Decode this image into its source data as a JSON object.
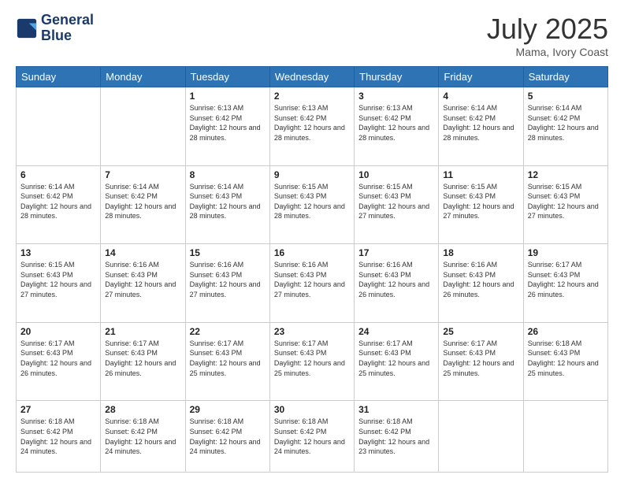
{
  "header": {
    "logo_line1": "General",
    "logo_line2": "Blue",
    "month_title": "July 2025",
    "location": "Mama, Ivory Coast"
  },
  "weekdays": [
    "Sunday",
    "Monday",
    "Tuesday",
    "Wednesday",
    "Thursday",
    "Friday",
    "Saturday"
  ],
  "weeks": [
    [
      {
        "day": "",
        "info": ""
      },
      {
        "day": "",
        "info": ""
      },
      {
        "day": "1",
        "info": "Sunrise: 6:13 AM\nSunset: 6:42 PM\nDaylight: 12 hours and 28 minutes."
      },
      {
        "day": "2",
        "info": "Sunrise: 6:13 AM\nSunset: 6:42 PM\nDaylight: 12 hours and 28 minutes."
      },
      {
        "day": "3",
        "info": "Sunrise: 6:13 AM\nSunset: 6:42 PM\nDaylight: 12 hours and 28 minutes."
      },
      {
        "day": "4",
        "info": "Sunrise: 6:14 AM\nSunset: 6:42 PM\nDaylight: 12 hours and 28 minutes."
      },
      {
        "day": "5",
        "info": "Sunrise: 6:14 AM\nSunset: 6:42 PM\nDaylight: 12 hours and 28 minutes."
      }
    ],
    [
      {
        "day": "6",
        "info": "Sunrise: 6:14 AM\nSunset: 6:42 PM\nDaylight: 12 hours and 28 minutes."
      },
      {
        "day": "7",
        "info": "Sunrise: 6:14 AM\nSunset: 6:42 PM\nDaylight: 12 hours and 28 minutes."
      },
      {
        "day": "8",
        "info": "Sunrise: 6:14 AM\nSunset: 6:43 PM\nDaylight: 12 hours and 28 minutes."
      },
      {
        "day": "9",
        "info": "Sunrise: 6:15 AM\nSunset: 6:43 PM\nDaylight: 12 hours and 28 minutes."
      },
      {
        "day": "10",
        "info": "Sunrise: 6:15 AM\nSunset: 6:43 PM\nDaylight: 12 hours and 27 minutes."
      },
      {
        "day": "11",
        "info": "Sunrise: 6:15 AM\nSunset: 6:43 PM\nDaylight: 12 hours and 27 minutes."
      },
      {
        "day": "12",
        "info": "Sunrise: 6:15 AM\nSunset: 6:43 PM\nDaylight: 12 hours and 27 minutes."
      }
    ],
    [
      {
        "day": "13",
        "info": "Sunrise: 6:15 AM\nSunset: 6:43 PM\nDaylight: 12 hours and 27 minutes."
      },
      {
        "day": "14",
        "info": "Sunrise: 6:16 AM\nSunset: 6:43 PM\nDaylight: 12 hours and 27 minutes."
      },
      {
        "day": "15",
        "info": "Sunrise: 6:16 AM\nSunset: 6:43 PM\nDaylight: 12 hours and 27 minutes."
      },
      {
        "day": "16",
        "info": "Sunrise: 6:16 AM\nSunset: 6:43 PM\nDaylight: 12 hours and 27 minutes."
      },
      {
        "day": "17",
        "info": "Sunrise: 6:16 AM\nSunset: 6:43 PM\nDaylight: 12 hours and 26 minutes."
      },
      {
        "day": "18",
        "info": "Sunrise: 6:16 AM\nSunset: 6:43 PM\nDaylight: 12 hours and 26 minutes."
      },
      {
        "day": "19",
        "info": "Sunrise: 6:17 AM\nSunset: 6:43 PM\nDaylight: 12 hours and 26 minutes."
      }
    ],
    [
      {
        "day": "20",
        "info": "Sunrise: 6:17 AM\nSunset: 6:43 PM\nDaylight: 12 hours and 26 minutes."
      },
      {
        "day": "21",
        "info": "Sunrise: 6:17 AM\nSunset: 6:43 PM\nDaylight: 12 hours and 26 minutes."
      },
      {
        "day": "22",
        "info": "Sunrise: 6:17 AM\nSunset: 6:43 PM\nDaylight: 12 hours and 25 minutes."
      },
      {
        "day": "23",
        "info": "Sunrise: 6:17 AM\nSunset: 6:43 PM\nDaylight: 12 hours and 25 minutes."
      },
      {
        "day": "24",
        "info": "Sunrise: 6:17 AM\nSunset: 6:43 PM\nDaylight: 12 hours and 25 minutes."
      },
      {
        "day": "25",
        "info": "Sunrise: 6:17 AM\nSunset: 6:43 PM\nDaylight: 12 hours and 25 minutes."
      },
      {
        "day": "26",
        "info": "Sunrise: 6:18 AM\nSunset: 6:43 PM\nDaylight: 12 hours and 25 minutes."
      }
    ],
    [
      {
        "day": "27",
        "info": "Sunrise: 6:18 AM\nSunset: 6:42 PM\nDaylight: 12 hours and 24 minutes."
      },
      {
        "day": "28",
        "info": "Sunrise: 6:18 AM\nSunset: 6:42 PM\nDaylight: 12 hours and 24 minutes."
      },
      {
        "day": "29",
        "info": "Sunrise: 6:18 AM\nSunset: 6:42 PM\nDaylight: 12 hours and 24 minutes."
      },
      {
        "day": "30",
        "info": "Sunrise: 6:18 AM\nSunset: 6:42 PM\nDaylight: 12 hours and 24 minutes."
      },
      {
        "day": "31",
        "info": "Sunrise: 6:18 AM\nSunset: 6:42 PM\nDaylight: 12 hours and 23 minutes."
      },
      {
        "day": "",
        "info": ""
      },
      {
        "day": "",
        "info": ""
      }
    ]
  ]
}
